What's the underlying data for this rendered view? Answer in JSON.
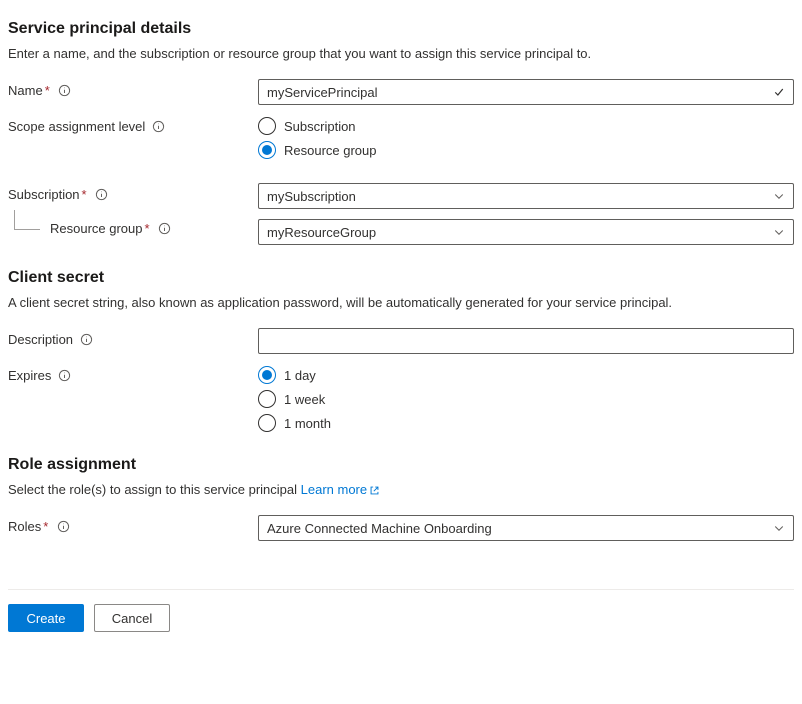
{
  "sp_details": {
    "heading": "Service principal details",
    "desc": "Enter a name, and the subscription or resource group that you want to assign this service principal to.",
    "name_label": "Name",
    "name_value": "myServicePrincipal",
    "scope_label": "Scope assignment level",
    "scope_options": {
      "subscription": "Subscription",
      "resource_group": "Resource group"
    },
    "scope_selected": "resource_group",
    "subscription_label": "Subscription",
    "subscription_value": "mySubscription",
    "resource_group_label": "Resource group",
    "resource_group_value": "myResourceGroup"
  },
  "client_secret": {
    "heading": "Client secret",
    "desc": "A client secret string, also known as application password, will be automatically generated for your service principal.",
    "description_label": "Description",
    "description_value": "",
    "expires_label": "Expires",
    "expires_options": {
      "d1": "1 day",
      "w1": "1 week",
      "m1": "1 month"
    },
    "expires_selected": "d1"
  },
  "role_assignment": {
    "heading": "Role assignment",
    "desc_prefix": "Select the role(s) to assign to this service principal ",
    "learn_more": "Learn more",
    "roles_label": "Roles",
    "roles_value": "Azure Connected Machine Onboarding"
  },
  "footer": {
    "create": "Create",
    "cancel": "Cancel"
  }
}
